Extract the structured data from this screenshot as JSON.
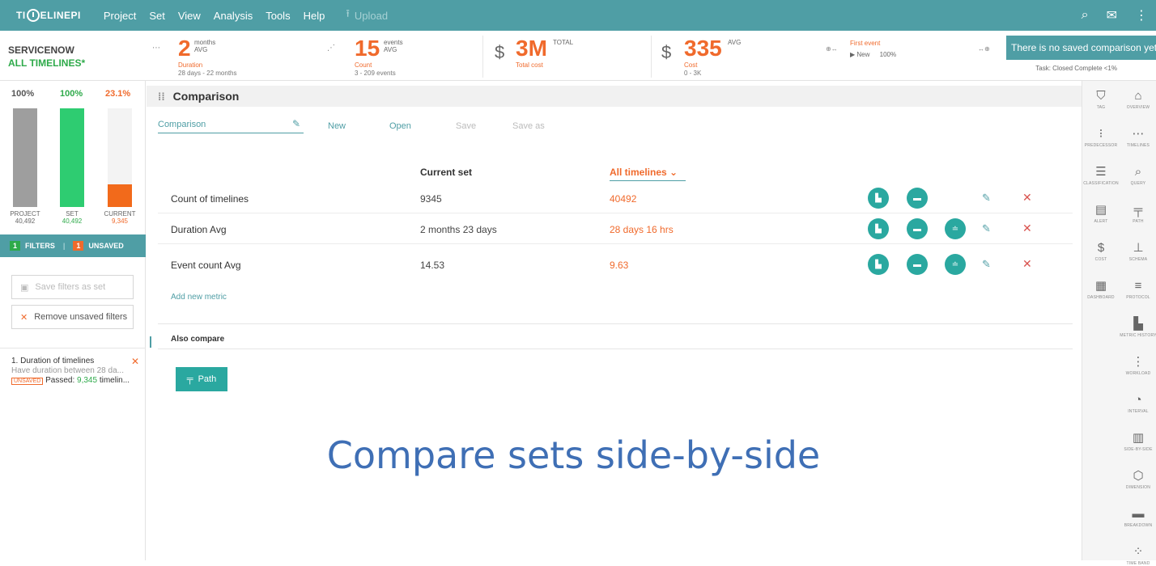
{
  "app": {
    "logo_left": "TI",
    "logo_right": "ELINEPI"
  },
  "menu": [
    "Project",
    "Set",
    "View",
    "Analysis",
    "Tools",
    "Help"
  ],
  "upload_label": "Upload",
  "project": {
    "name": "SERVICENOW",
    "set": "ALL TIMELINES*"
  },
  "stats": {
    "duration": {
      "value": "2",
      "unit_top": "months",
      "unit_bottom": "AVG",
      "label": "Duration",
      "sub": "28 days - 22 months"
    },
    "count": {
      "value": "15",
      "unit_top": "events",
      "unit_bottom": "AVG",
      "label": "Count",
      "sub": "3 - 209 events"
    },
    "total_cost": {
      "currency": "$",
      "value": "3M",
      "unit": "TOTAL",
      "label": "Total cost"
    },
    "cost": {
      "currency": "$",
      "value": "335",
      "unit": "AVG",
      "label": "Cost",
      "sub": "0 - 3K"
    },
    "first_event": {
      "label": "First event",
      "value": "New",
      "pct": "100%"
    },
    "toast": "There is no saved comparison yet.",
    "task": "Task: Closed Complete  <1%"
  },
  "left": {
    "pct_project": "100%",
    "pct_set": "100%",
    "pct_current": "23.1%",
    "bars": [
      {
        "name": "PROJECT",
        "count": "40,492",
        "fill": 1.0,
        "color": "#9e9e9e"
      },
      {
        "name": "SET",
        "count": "40,492",
        "fill": 1.0,
        "color": "#2ecc71"
      },
      {
        "name": "CURRENT",
        "count": "9,345",
        "fill": 0.231,
        "color": "#f26a1b"
      }
    ],
    "filters_count": "1",
    "filters_label": "FILTERS",
    "unsaved_count": "1",
    "unsaved_label": "UNSAVED",
    "save_filters": "Save filters as set",
    "remove_filters": "Remove unsaved filters",
    "filter_item": {
      "title": "1. Duration of timelines",
      "desc": "Have duration between 28 da...",
      "badge": "UNSAVED",
      "passed_prefix": "Passed:",
      "passed_count": "9,345",
      "passed_suffix": "timelin..."
    }
  },
  "main": {
    "title": "Comparison",
    "comparison_name": "Comparison",
    "actions": {
      "new": "New",
      "open": "Open",
      "save": "Save",
      "save_as": "Save as"
    },
    "col_current": "Current set",
    "col_all": "All timelines",
    "rows": [
      {
        "label": "Count of timelines",
        "current": "9345",
        "all": "40492"
      },
      {
        "label": "Duration Avg",
        "current": "2 months 23 days",
        "all": "28 days 16 hrs"
      },
      {
        "label": "Event count Avg",
        "current": "14.53",
        "all": "9.63"
      }
    ],
    "add_metric": "Add new metric",
    "also_compare": "Also compare",
    "path_button": "Path",
    "caption": "Compare sets side-by-side"
  },
  "rail": [
    {
      "icon": "tag-icon",
      "glyph": "⛉",
      "label": "TAG"
    },
    {
      "icon": "home-icon",
      "glyph": "⌂",
      "label": "OVERVIEW"
    },
    {
      "icon": "predecessor-icon",
      "glyph": "⁝",
      "label": "PREDECESSOR"
    },
    {
      "icon": "timelines-icon",
      "glyph": "⋯",
      "label": "TIMELINES"
    },
    {
      "icon": "classification-icon",
      "glyph": "☰",
      "label": "CLASSIFICATION"
    },
    {
      "icon": "query-icon",
      "glyph": "⌕",
      "label": "QUERY"
    },
    {
      "icon": "alert-icon",
      "glyph": "▤",
      "label": "ALERT"
    },
    {
      "icon": "path-icon",
      "glyph": "╤",
      "label": "PATH"
    },
    {
      "icon": "cost-icon",
      "glyph": "$",
      "label": "COST"
    },
    {
      "icon": "schema-icon",
      "glyph": "⊥",
      "label": "SCHEMA"
    },
    {
      "icon": "dashboard-icon",
      "glyph": "▦",
      "label": "DASHBOARD"
    },
    {
      "icon": "protocol-icon",
      "glyph": "≡",
      "label": "PROTOCOL"
    },
    {
      "icon": "metric-history-icon",
      "glyph": "▙",
      "label": "METRIC HISTORY"
    },
    {
      "icon": "workload-icon",
      "glyph": "⋮",
      "label": "WORKLOAD"
    },
    {
      "icon": "interval-icon",
      "glyph": "◔",
      "label": "INTERVAL"
    },
    {
      "icon": "side-by-side-icon",
      "glyph": "▥",
      "label": "SIDE-BY-SIDE"
    },
    {
      "icon": "dimension-icon",
      "glyph": "⬡",
      "label": "DIMENSION"
    },
    {
      "icon": "breakdown-icon",
      "glyph": "▬",
      "label": "BREAKDOWN"
    },
    {
      "icon": "time-band-icon",
      "glyph": "⁘",
      "label": "TIME BAND"
    }
  ],
  "colors": {
    "accent": "#4f9ea5",
    "orange": "#f06a2c",
    "green": "#2eaa4a",
    "circle": "#2aa8a0"
  }
}
